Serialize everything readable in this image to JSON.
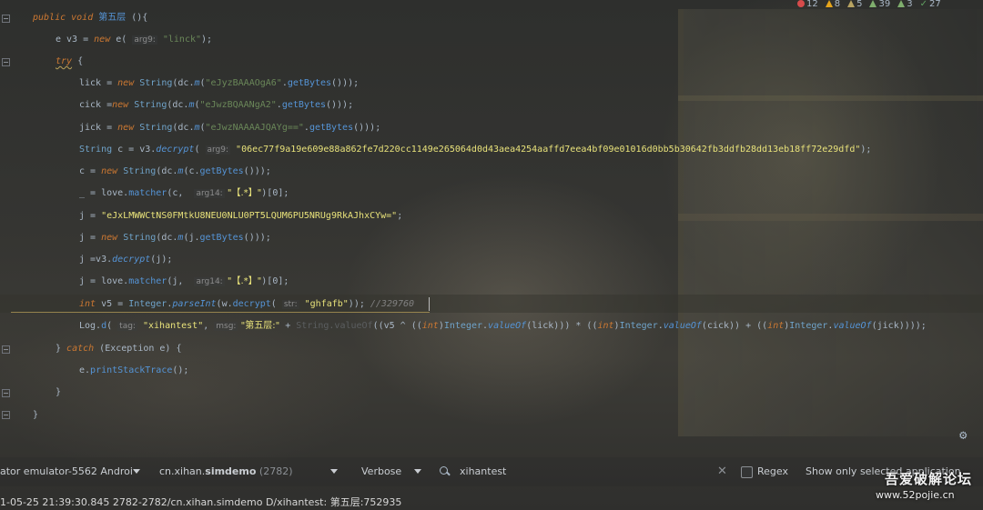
{
  "inspections": {
    "errors": "12",
    "warnings": "8",
    "weak_warnings": "5",
    "typos": "39",
    "infos": "3",
    "ok": "27"
  },
  "code": {
    "l1": {
      "kw1": "public void ",
      "name": "第五层",
      "rest": " (){"
    },
    "l2": {
      "a": "e v3 = ",
      "kw": "new",
      "b": " e( ",
      "hint": "arg9:",
      "s": " \"linck\"",
      "c": ");"
    },
    "l3": {
      "kw": "try",
      "rest": " {"
    },
    "l4": {
      "a": "lick = ",
      "kw": "new",
      "b": " ",
      "cls": "String",
      "c": "(",
      "dc": "dc.",
      "m": "m",
      "d": "(",
      "s": "\"eJyzBAAAOgA6\"",
      "e": ".",
      "gb": "getBytes",
      "f": "()));"
    },
    "l5": {
      "a": "cick =",
      "kw": "new",
      "b": " ",
      "cls": "String",
      "c": "(",
      "dc": "dc.",
      "m": "m",
      "d": "(",
      "s": "\"eJwzBQAANgA2\"",
      "e": ".",
      "gb": "getBytes",
      "f": "()));"
    },
    "l6": {
      "a": "jick = ",
      "kw": "new",
      "b": " ",
      "cls": "String",
      "c": "(",
      "dc": "dc.",
      "m": "m",
      "d": "(",
      "s": "\"eJwzNAAAAJQAYg==\"",
      "e": ".",
      "gb": "getBytes",
      "f": "()));"
    },
    "l7": {
      "cls": "String",
      "a": " c = v3.",
      "m": "decrypt",
      "b": "( ",
      "hint": "arg9:",
      "s": " \"06ec77f9a19e609e88a862fe7d220cc1149e265064d0d43aea4254aaffd7eea4bf09e01016d0bb5b30642fb3ddfb28dd13eb18ff72e29dfd\"",
      "c": ");"
    },
    "l8": {
      "a": "c = ",
      "kw": "new",
      "b": " ",
      "cls": "String",
      "c": "(",
      "dc": "dc.",
      "m": "m",
      "d": "(c.",
      "gb": "getBytes",
      "f": "()));"
    },
    "l9": {
      "a": "_ = love.",
      "m": "matcher",
      "b": "(c,  ",
      "hint": "arg14:",
      "s": " \"【.*】\"",
      "c": ")[0];"
    },
    "l10": {
      "a": "j = ",
      "s": "\"eJxLMWWCtNS0FMtkU8NEU0NLU0PT5LQUM6PU5NRUg9RkAJhxCYw=\"",
      "c": ";"
    },
    "l11": {
      "a": "j = ",
      "kw": "new",
      "b": " ",
      "cls": "String",
      "c": "(",
      "dc": "dc.",
      "m": "m",
      "d": "(j.",
      "gb": "getBytes",
      "f": "()));"
    },
    "l12": {
      "a": "j =v3.",
      "m": "decrypt",
      "b": "(j);"
    },
    "l13": {
      "a": "j = love.",
      "m": "matcher",
      "b": "(j,  ",
      "hint": "arg14:",
      "s": " \"【.*】\"",
      "c": ")[0];"
    },
    "l14": {
      "kw": "int",
      "a": " v5 = ",
      "cls": "Integer",
      "b": ".",
      "m": "parseInt",
      "c": "(w.",
      "m2": "decrypt",
      "d": "( ",
      "hint": "str:",
      "s": " \"ghfafb\"",
      "e": "));",
      "cmt": " //329760"
    },
    "l15": {
      "a": "Log.",
      "m": "d",
      "b": "( ",
      "hint1": "tag:",
      "s1": " \"xihantest\"",
      "c": ", ",
      "hint2": "msg:",
      "s2": " \"第五层:\"",
      "d": " + ",
      "dim": "String.valueOf",
      "e": "((v5 ^ ((",
      "kw1": "int",
      "f": ")",
      "cls1": "Integer",
      "g": ".",
      "m1": "valueOf",
      "h": "(lick))) * ((",
      "kw2": "int",
      "i": ")",
      "cls2": "Integer",
      "j": ".",
      "m2": "valueOf",
      "k": "(cick)) + ((",
      "kw3": "int",
      "l": ")",
      "cls3": "Integer",
      "mm": ".",
      "m3": "valueOf",
      "n": "(jick))));"
    },
    "l16": {
      "a": "} ",
      "kw": "catch",
      "b": " (Exception e) {"
    },
    "l17": {
      "a": "e.",
      "m": "printStackTrace",
      "b": "();"
    },
    "l18": {
      "a": "}"
    },
    "l19": {
      "a": "}"
    }
  },
  "logcat": {
    "device": "ator emulator-5562 Androi",
    "package_prefix": "cn.xihan.",
    "package_bold": "simdemo",
    "pid": "(2782)",
    "level": "Verbose",
    "search_value": "xihantest",
    "regex_label": "Regex",
    "filter_label": "Show only selected application",
    "log_line": "1-05-25 21:39:30.845 2782-2782/cn.xihan.simdemo D/xihantest: 第五层:752935"
  },
  "watermark": {
    "title": "吾爱破解论坛",
    "url": "www.52pojie.cn"
  }
}
